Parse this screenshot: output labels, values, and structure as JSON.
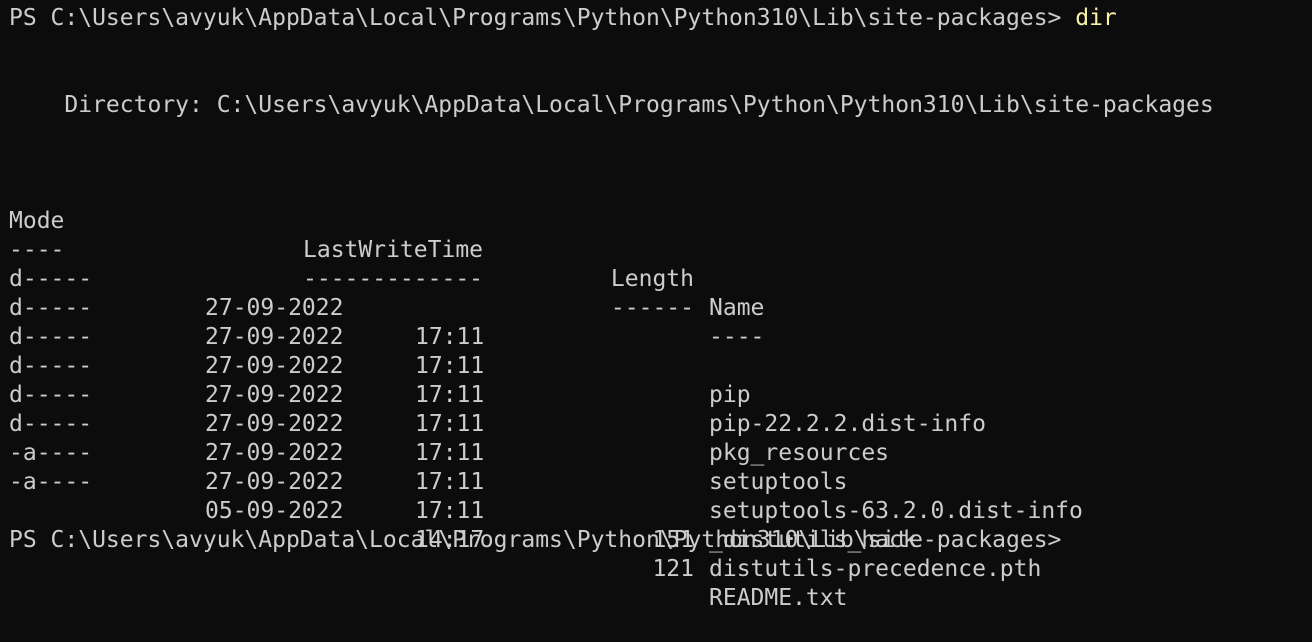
{
  "prompt_top": {
    "text": "PS C:\\Users\\avyuk\\AppData\\Local\\Programs\\Python\\Python310\\Lib\\site-packages> ",
    "command": "dir"
  },
  "directory_line": "    Directory: C:\\Users\\avyuk\\AppData\\Local\\Programs\\Python\\Python310\\Lib\\site-packages",
  "headers": {
    "mode": "Mode",
    "lastwritetime": "LastWriteTime",
    "length": "Length",
    "name": "Name"
  },
  "underlines": {
    "mode": "----",
    "lastwritetime": "-------------",
    "length": "------",
    "name": "----"
  },
  "rows": [
    {
      "mode": "d-----",
      "date": "27-09-2022",
      "time": "17:11",
      "length": "",
      "name": "pip"
    },
    {
      "mode": "d-----",
      "date": "27-09-2022",
      "time": "17:11",
      "length": "",
      "name": "pip-22.2.2.dist-info"
    },
    {
      "mode": "d-----",
      "date": "27-09-2022",
      "time": "17:11",
      "length": "",
      "name": "pkg_resources"
    },
    {
      "mode": "d-----",
      "date": "27-09-2022",
      "time": "17:11",
      "length": "",
      "name": "setuptools"
    },
    {
      "mode": "d-----",
      "date": "27-09-2022",
      "time": "17:11",
      "length": "",
      "name": "setuptools-63.2.0.dist-info"
    },
    {
      "mode": "d-----",
      "date": "27-09-2022",
      "time": "17:11",
      "length": "",
      "name": "_distutils_hack"
    },
    {
      "mode": "-a----",
      "date": "27-09-2022",
      "time": "17:11",
      "length": "151",
      "name": "distutils-precedence.pth"
    },
    {
      "mode": "-a----",
      "date": "05-09-2022",
      "time": "14:17",
      "length": "121",
      "name": "README.txt"
    }
  ],
  "prompt_bottom": "PS C:\\Users\\avyuk\\AppData\\Local\\Programs\\Python\\Python310\\Lib\\site-packages>",
  "colors": {
    "background": "#0c0c0c",
    "foreground": "#cccccc",
    "command": "#f9f1a5"
  }
}
